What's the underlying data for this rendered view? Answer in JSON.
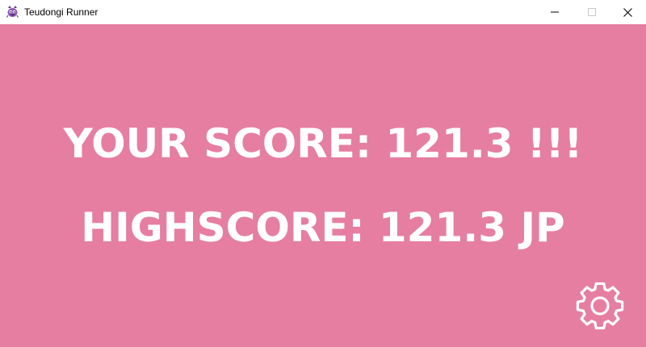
{
  "window": {
    "title": "Teudongi Runner",
    "icon": "purple-creature-icon",
    "controls": {
      "minimize": "minimize-icon",
      "maximize": "maximize-icon",
      "close": "close-icon"
    }
  },
  "game": {
    "background_color": "#e67ea2",
    "text_color": "#ffffff",
    "your_score_text": "YOUR SCORE: 121.3 !!!",
    "highscore_text": "HIGHSCORE: 121.3 JP",
    "settings_icon": "gear-icon"
  }
}
